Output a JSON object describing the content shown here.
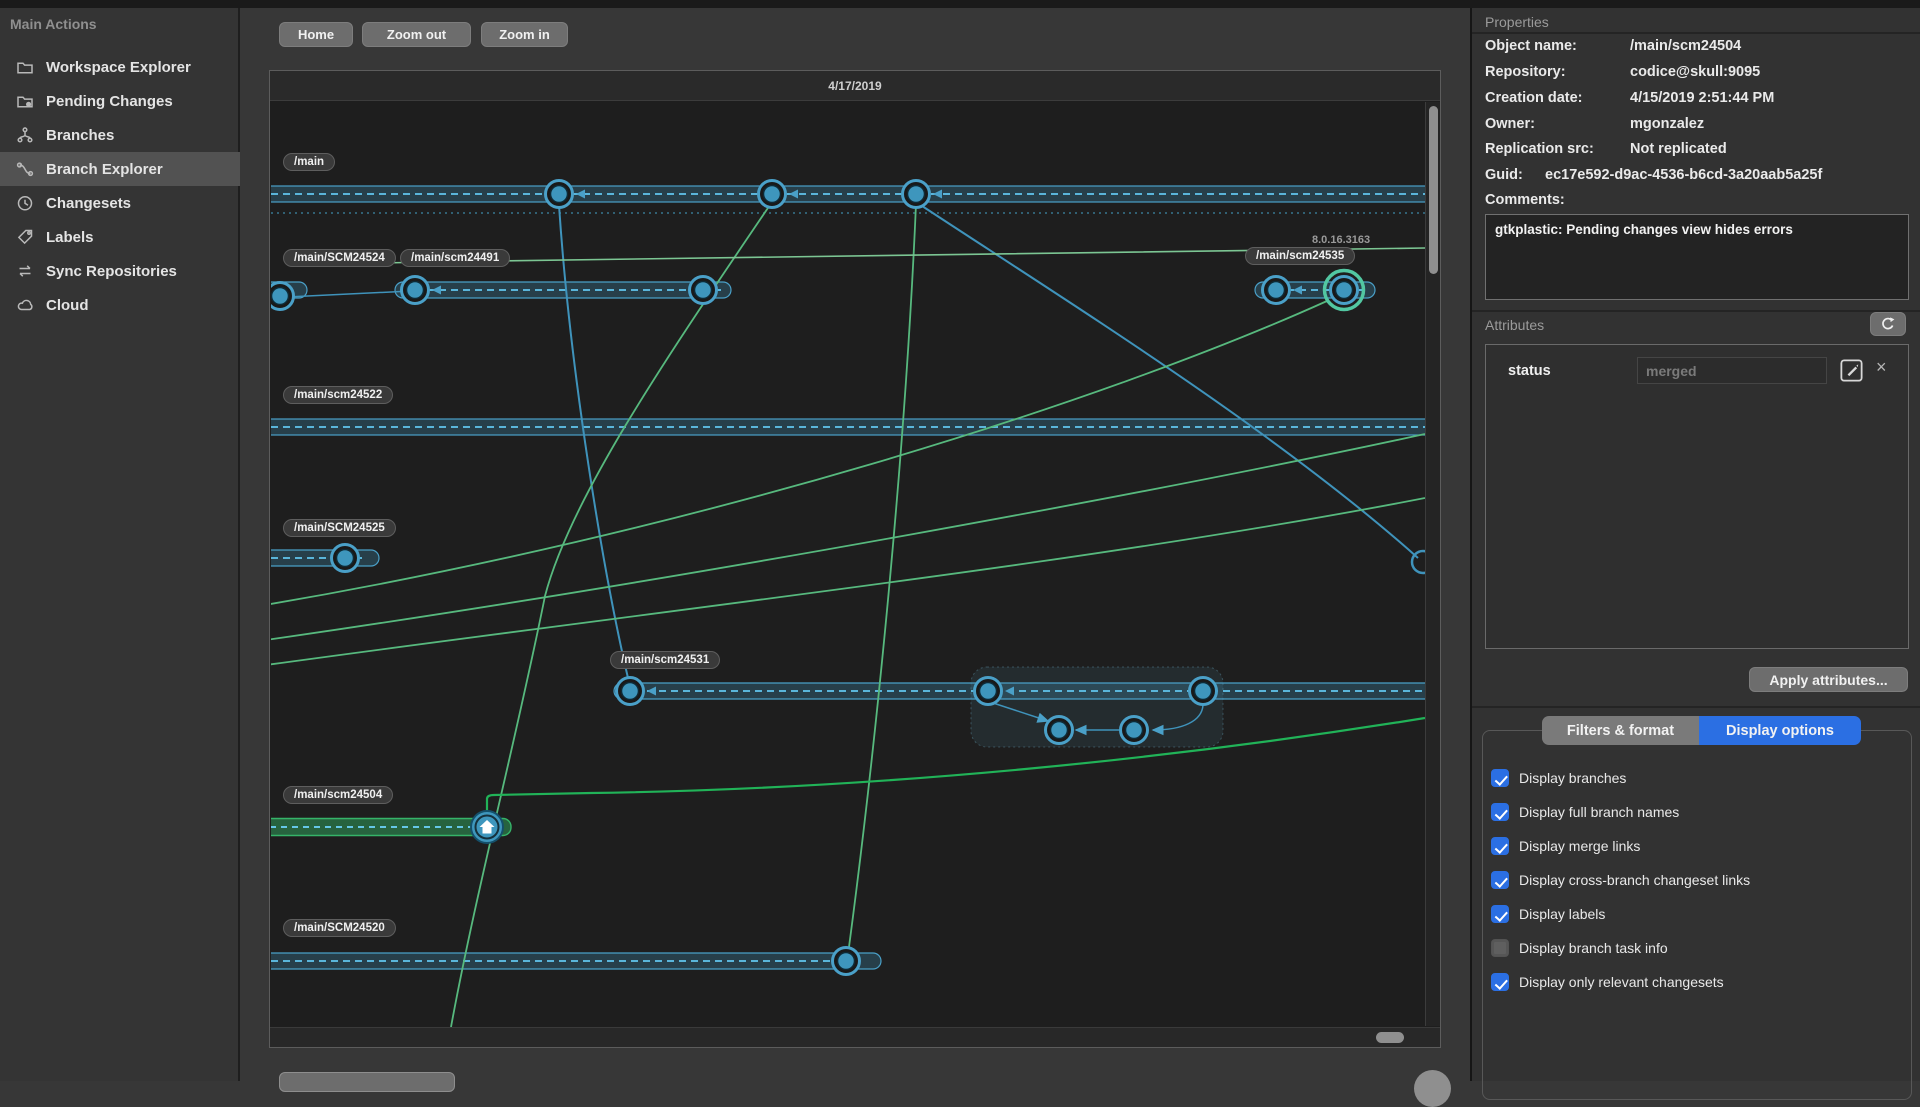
{
  "sidebar": {
    "title": "Main Actions",
    "items": [
      {
        "label": "Workspace Explorer",
        "icon": "folder-icon",
        "selected": false
      },
      {
        "label": "Pending Changes",
        "icon": "folder-pending-icon",
        "selected": false
      },
      {
        "label": "Branches",
        "icon": "branches-icon",
        "selected": false
      },
      {
        "label": "Branch Explorer",
        "icon": "branch-explorer-icon",
        "selected": true
      },
      {
        "label": "Changesets",
        "icon": "clock-icon",
        "selected": false
      },
      {
        "label": "Labels",
        "icon": "tag-icon",
        "selected": false
      },
      {
        "label": "Sync Repositories",
        "icon": "sync-icon",
        "selected": false
      },
      {
        "label": "Cloud",
        "icon": "cloud-icon",
        "selected": false
      }
    ]
  },
  "toolbar": {
    "home_label": "Home",
    "zoom_out_label": "Zoom out",
    "zoom_in_label": "Zoom in"
  },
  "canvas": {
    "date_header": "4/17/2019",
    "version_label": "8.0.16.3163",
    "branch_labels": [
      "/main",
      "/main/SCM24524",
      "/main/scm24491",
      "/main/scm24535",
      "/main/scm24522",
      "/main/SCM24525",
      "/main/scm24531",
      "/main/scm24504",
      "/main/SCM24520"
    ]
  },
  "properties": {
    "title": "Properties",
    "fields": [
      {
        "label": "Object name:",
        "value": "/main/scm24504"
      },
      {
        "label": "Repository:",
        "value": "codice@skull:9095"
      },
      {
        "label": "Creation date:",
        "value": "4/15/2019 2:51:44 PM"
      },
      {
        "label": "Owner:",
        "value": "mgonzalez"
      },
      {
        "label": "Replication src:",
        "value": "Not replicated"
      },
      {
        "label": "Guid:",
        "value": "ec17e592-d9ac-4536-b6cd-3a20aab5a25f"
      }
    ],
    "comments_label": "Comments:",
    "comments_text": "gtkplastic: Pending changes view hides errors"
  },
  "attributes": {
    "title": "Attributes",
    "row": {
      "name": "status",
      "value": "merged"
    },
    "apply_label": "Apply attributes..."
  },
  "options": {
    "tabs": [
      {
        "label": "Filters & format",
        "active": false
      },
      {
        "label": "Display options",
        "active": true
      }
    ],
    "checkboxes": [
      {
        "label": "Display branches",
        "checked": true
      },
      {
        "label": "Display full branch names",
        "checked": true
      },
      {
        "label": "Display merge links",
        "checked": true
      },
      {
        "label": "Display cross-branch changeset links",
        "checked": true
      },
      {
        "label": "Display labels",
        "checked": true
      },
      {
        "label": "Display branch task info",
        "checked": false
      },
      {
        "label": "Display only relevant changesets",
        "checked": true
      }
    ]
  },
  "colors": {
    "accent_blue": "#2b6fe3",
    "branch_blue": "#4aa0c8",
    "node_fill": "#3e96bd",
    "merge_green": "#57b97e",
    "selected_teal": "#52c7a2",
    "highlight_green": "#21b358"
  }
}
